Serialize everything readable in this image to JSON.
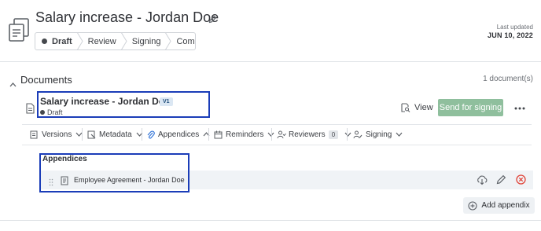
{
  "header": {
    "title": "Salary increase - Jordan Doe",
    "last_updated_label": "Last updated",
    "last_updated_date": "JUN 10, 2022"
  },
  "stepper": {
    "steps": [
      {
        "label": "Draft",
        "current": true
      },
      {
        "label": "Review",
        "current": false
      },
      {
        "label": "Signing",
        "current": false
      },
      {
        "label": "Complete",
        "current": false
      }
    ]
  },
  "documents": {
    "section_title": "Documents",
    "count_text": "1 document(s)",
    "item": {
      "name": "Salary increase - Jordan Doe",
      "version": "V1",
      "status": "Draft",
      "view_label": "View",
      "send_label": "Send for signing"
    },
    "toolbar": {
      "versions": "Versions",
      "metadata": "Metadata",
      "appendices": "Appendices",
      "reminders": "Reminders",
      "reviewers": "Reviewers",
      "reviewers_count": "0",
      "signing": "Signing"
    },
    "appendices": {
      "heading": "Appendices",
      "items": [
        {
          "name": "Employee Agreement - Jordan Doe"
        }
      ],
      "add_label": "Add appendix"
    }
  },
  "colors": {
    "accent_green": "#8fbf9d",
    "highlight_blue": "#1b3db8",
    "delete_red": "#e0453a"
  }
}
